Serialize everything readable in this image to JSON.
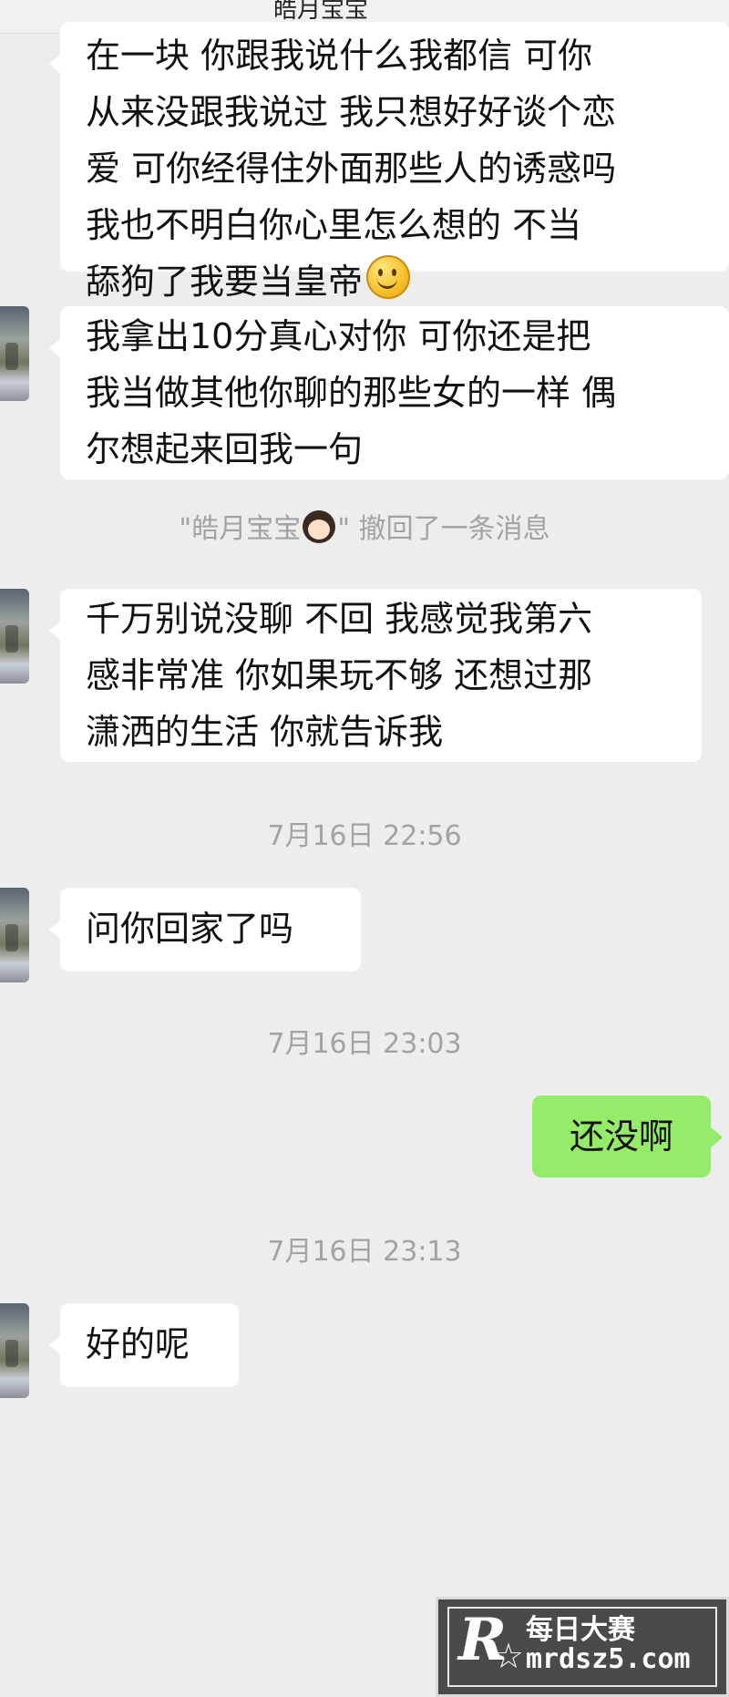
{
  "header": {
    "title_fragment": "皓月宝宝"
  },
  "messages": [
    {
      "lines": [
        "在一块 你跟我说什么我都信 可你",
        "从来没跟我说过 我只想好好谈个恋",
        "爱 可你经得住外面那些人的诱惑吗",
        " 我也不明白你心里怎么想的 不当",
        "舔狗了我要当皇帝"
      ],
      "emoji": "smile-emoji"
    },
    {
      "lines": [
        "我拿出10分真心对你 可你还是把",
        "我当做其他你聊的那些女的一样 偶",
        "尔想起来回我一句"
      ]
    },
    {
      "lines": [
        "千万别说没聊 不回 我感觉我第六",
        "感非常准 你如果玩不够 还想过那",
        "潇洒的生活 你就告诉我"
      ]
    },
    {
      "lines": [
        "问你回家了吗"
      ]
    },
    {
      "lines": [
        "还没啊"
      ]
    },
    {
      "lines": [
        "好的呢"
      ]
    }
  ],
  "system": {
    "recall_prefix": "\"皓月宝宝",
    "recall_suffix": "\" 撤回了一条消息",
    "time_1": "7月16日 22:56",
    "time_2": "7月16日 23:03",
    "time_3": "7月16日 23:13"
  },
  "watermark": {
    "logo": "R",
    "name": "每日大赛",
    "url": "mrdsz5.com"
  },
  "colors": {
    "background": "#ededed",
    "incoming_bubble": "#ffffff",
    "outgoing_bubble": "#95ec69",
    "system_text": "#a3a3a3"
  }
}
